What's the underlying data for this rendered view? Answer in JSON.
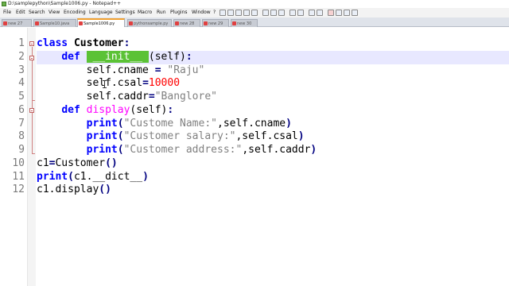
{
  "window": {
    "title": "D:\\samplepython\\Sample1006.py - Notepad++"
  },
  "menu": [
    "File",
    "Edit",
    "Search",
    "View",
    "Encoding",
    "Language",
    "Settings",
    "Macro",
    "Run",
    "Plugins",
    "Window",
    "?"
  ],
  "tabs": [
    {
      "label": "new 27",
      "active": false
    },
    {
      "label": "Sample10.java",
      "active": false
    },
    {
      "label": "Sample1006.py",
      "active": true
    },
    {
      "label": "pythonsample.py",
      "active": false
    },
    {
      "label": "new 28",
      "active": false
    },
    {
      "label": "new 29",
      "active": false
    },
    {
      "label": "new 30",
      "active": false
    }
  ],
  "editor": {
    "line_numbers": [
      "1",
      "2",
      "3",
      "4",
      "5",
      "6",
      "7",
      "8",
      "9",
      "10",
      "11",
      "12"
    ],
    "current_line": "2",
    "lines": [
      [
        {
          "t": "class ",
          "c": "kw"
        },
        {
          "t": "Customer",
          "c": "cls"
        },
        {
          "t": ":",
          "c": "op"
        }
      ],
      [
        {
          "t": "    ",
          "c": "plain"
        },
        {
          "t": "def ",
          "c": "kw"
        },
        {
          "t": " __init__ ",
          "c": "sel"
        },
        {
          "t": "(self)",
          "c": "plain"
        },
        {
          "t": ":",
          "c": "op"
        }
      ],
      [
        {
          "t": "        self.cname ",
          "c": "plain"
        },
        {
          "t": "=",
          "c": "op"
        },
        {
          "t": " \"Raju\"",
          "c": "str"
        }
      ],
      [
        {
          "t": "        self.csal",
          "c": "plain"
        },
        {
          "t": "=",
          "c": "op"
        },
        {
          "t": "10000",
          "c": "num"
        }
      ],
      [
        {
          "t": "        self.caddr",
          "c": "plain"
        },
        {
          "t": "=",
          "c": "op"
        },
        {
          "t": "\"Banglore\"",
          "c": "str"
        }
      ],
      [
        {
          "t": "    ",
          "c": "plain"
        },
        {
          "t": "def ",
          "c": "kw"
        },
        {
          "t": "display",
          "c": "fn"
        },
        {
          "t": "(self)",
          "c": "plain"
        },
        {
          "t": ":",
          "c": "op"
        }
      ],
      [
        {
          "t": "        ",
          "c": "plain"
        },
        {
          "t": "print",
          "c": "kw"
        },
        {
          "t": "(",
          "c": "op"
        },
        {
          "t": "\"Custome Name:\"",
          "c": "str"
        },
        {
          "t": ",self.cname",
          "c": "plain"
        },
        {
          "t": ")",
          "c": "op"
        }
      ],
      [
        {
          "t": "        ",
          "c": "plain"
        },
        {
          "t": "print",
          "c": "kw"
        },
        {
          "t": "(",
          "c": "op"
        },
        {
          "t": "\"Customer salary:\"",
          "c": "str"
        },
        {
          "t": ",self.csal",
          "c": "plain"
        },
        {
          "t": ")",
          "c": "op"
        }
      ],
      [
        {
          "t": "        ",
          "c": "plain"
        },
        {
          "t": "print",
          "c": "kw"
        },
        {
          "t": "(",
          "c": "op"
        },
        {
          "t": "\"Customer address:\"",
          "c": "str"
        },
        {
          "t": ",self.caddr",
          "c": "plain"
        },
        {
          "t": ")",
          "c": "op"
        }
      ],
      [
        {
          "t": "c1",
          "c": "plain"
        },
        {
          "t": "=",
          "c": "op"
        },
        {
          "t": "Customer",
          "c": "plain"
        },
        {
          "t": "()",
          "c": "op"
        }
      ],
      [
        {
          "t": "print",
          "c": "kw"
        },
        {
          "t": "(",
          "c": "op"
        },
        {
          "t": "c1.__dict__",
          "c": "plain"
        },
        {
          "t": ")",
          "c": "op"
        }
      ],
      [
        {
          "t": "c1.display",
          "c": "plain"
        },
        {
          "t": "()",
          "c": "op"
        }
      ]
    ]
  },
  "colors": {
    "keyword": "#0000ff",
    "string": "#808080",
    "number": "#ff0000",
    "function": "#ff00ff",
    "selection": "#5bc236",
    "current_line": "#e8e8ff"
  }
}
